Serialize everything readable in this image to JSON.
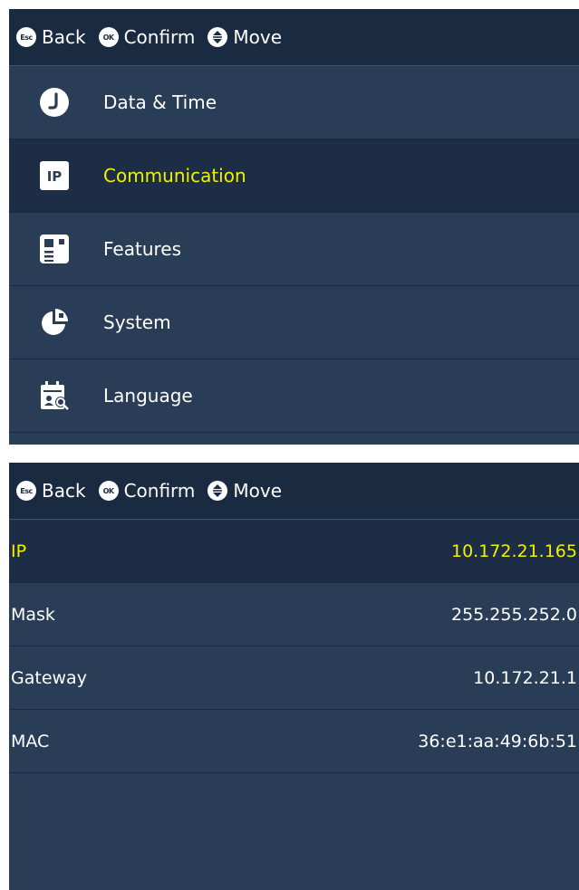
{
  "nav_hints": {
    "back": {
      "key_glyph": "Esc",
      "label": "Back"
    },
    "confirm": {
      "key_glyph": "OK",
      "label": "Confirm"
    },
    "move": {
      "label": "Move"
    }
  },
  "menu": {
    "items": [
      {
        "label": "Data & Time",
        "icon": "clock-icon",
        "selected": false
      },
      {
        "label": "Communication",
        "icon": "ip-icon",
        "icon_text": "IP",
        "selected": true
      },
      {
        "label": "Features",
        "icon": "features-icon",
        "selected": false
      },
      {
        "label": "System",
        "icon": "pie-chart-icon",
        "selected": false
      },
      {
        "label": "Language",
        "icon": "language-icon",
        "selected": false
      }
    ]
  },
  "communication": {
    "rows": [
      {
        "label": "IP",
        "value": "10.172.21.165",
        "selected": true
      },
      {
        "label": "Mask",
        "value": "255.255.252.0",
        "selected": false
      },
      {
        "label": "Gateway",
        "value": "10.172.21.1",
        "selected": false
      },
      {
        "label": "MAC",
        "value": "36:e1:aa:49:6b:51",
        "selected": false
      }
    ]
  },
  "colors": {
    "panel_bg": "#2a3d57",
    "topbar_bg": "#1a2a40",
    "selected_bg": "#1c2d45",
    "highlight_text": "#f2f200",
    "text": "#ffffff"
  }
}
